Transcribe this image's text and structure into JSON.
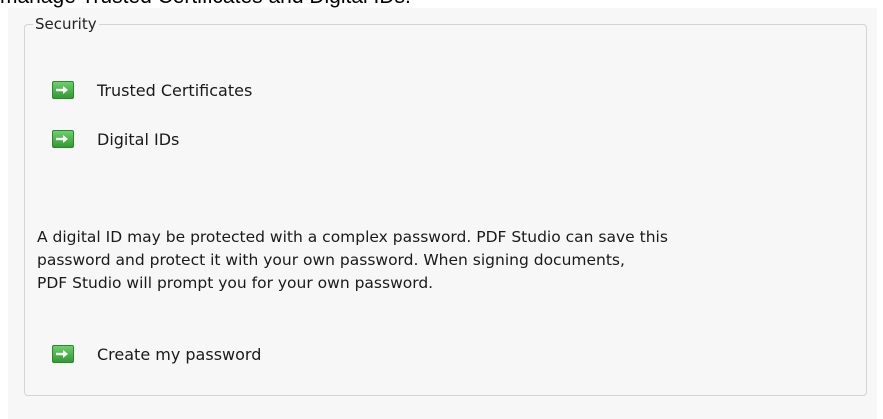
{
  "header": {
    "caption": "manage Trusted Certificates and Digital IDs."
  },
  "security": {
    "title": "Security",
    "links": [
      {
        "label": "Trusted Certificates",
        "icon": "green-arrow-icon"
      },
      {
        "label": "Digital IDs",
        "icon": "green-arrow-icon"
      }
    ],
    "info_lines": [
      "A digital ID may be protected with a complex password. PDF Studio can save this",
      "password and protect it with your own password. When signing documents,",
      "PDF Studio will prompt you for your own password."
    ],
    "create_password": {
      "label": "Create my password",
      "icon": "green-arrow-icon"
    }
  },
  "colors": {
    "arrow_green": "#3aa63a",
    "panel_background": "#f7f7f7",
    "border": "#d4d4d4"
  }
}
